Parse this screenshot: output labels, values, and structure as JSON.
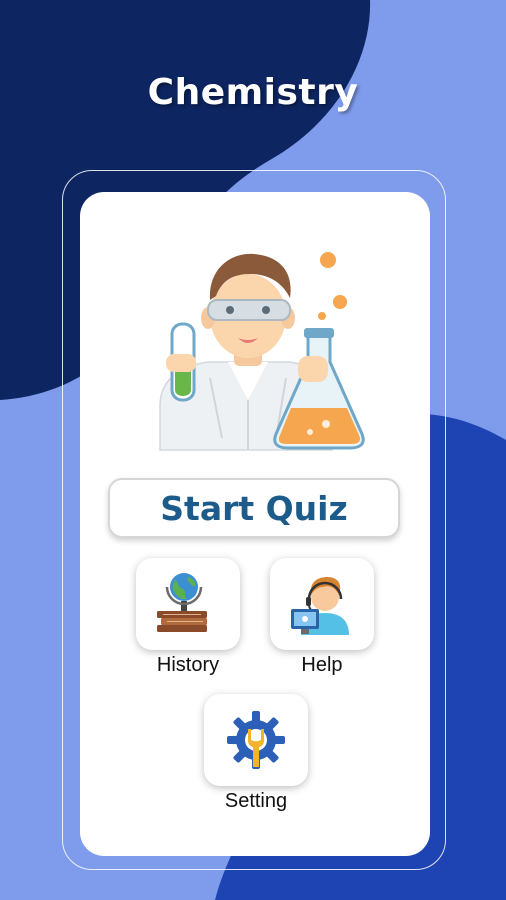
{
  "app": {
    "title": "Chemistry"
  },
  "main": {
    "start_label": "Start Quiz",
    "menu": [
      {
        "label": "History",
        "icon": "globe-books-icon"
      },
      {
        "label": "Help",
        "icon": "support-agent-icon"
      },
      {
        "label": "Setting",
        "icon": "gear-wrench-icon"
      }
    ]
  },
  "colors": {
    "dark_navy": "#0d2560",
    "light_blue": "#7f9bec",
    "royal_blue": "#1e44b4",
    "accent_text": "#1d5c8a",
    "flask_orange": "#f5a64e"
  },
  "icons": {
    "hero": "chemist-icon"
  }
}
